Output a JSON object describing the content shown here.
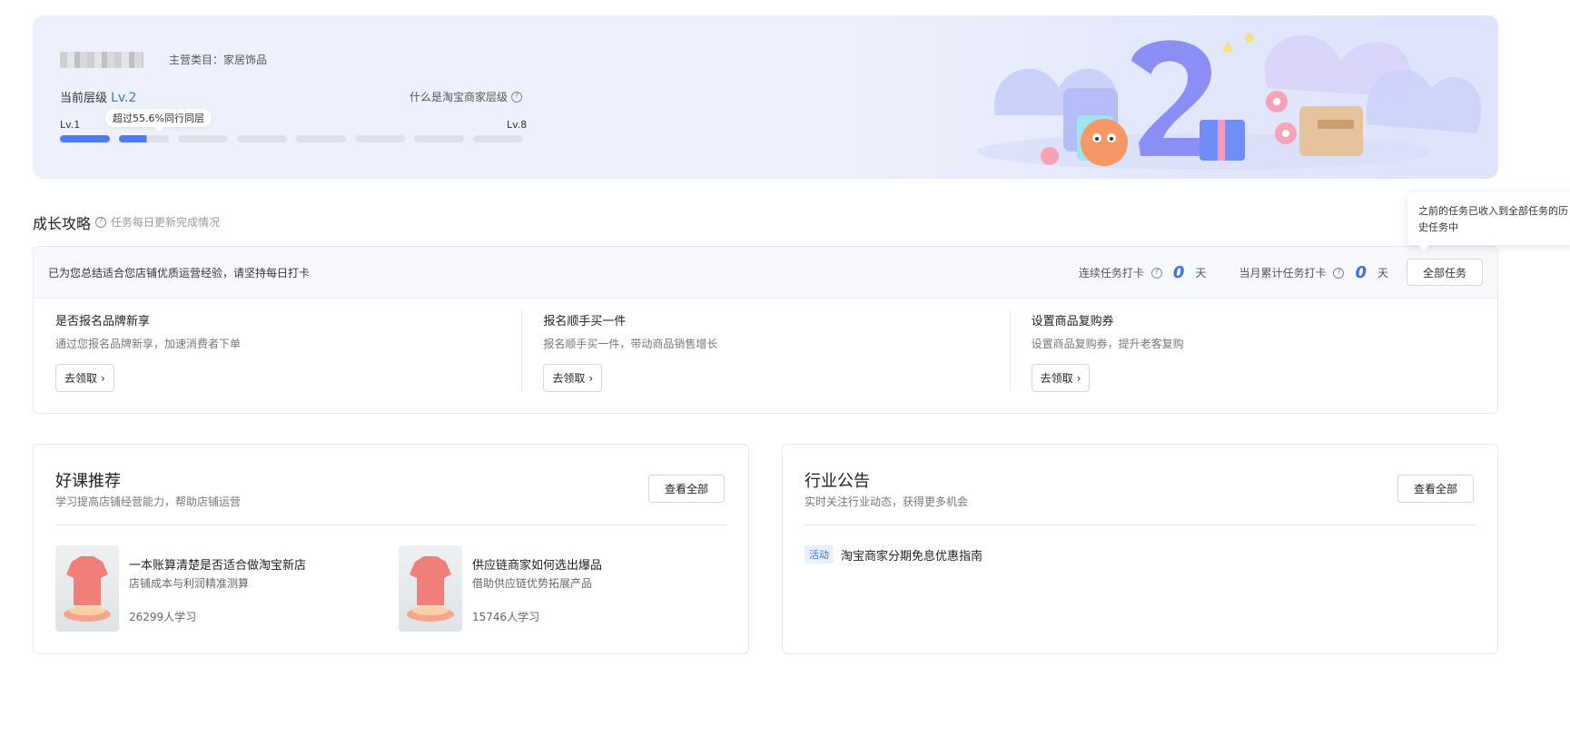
{
  "banner": {
    "category": "主营类目：家居饰品",
    "level_label": "当前层级",
    "level_value": "Lv.2",
    "what_level": "什么是淘宝商家层级",
    "level_start": "Lv.1",
    "level_end": "Lv.8",
    "beat_tip": "超过55.6%同行同层",
    "progress_segments": 8,
    "progress_completed": 1.55
  },
  "growth": {
    "title": "成长攻略",
    "subtitle": "任务每日更新完成情况",
    "head_text": "已为您总结适合您店铺优质运营经验，请坚持每日打卡",
    "streak_label": "连续任务打卡",
    "streak_value": "0",
    "streak_unit": "天",
    "month_label": "当月累计任务打卡",
    "month_value": "0",
    "month_unit": "天",
    "all_tasks_label": "全部任务",
    "popover_text": "之前的任务已收入到全部任务的历史任务中",
    "tasks": [
      {
        "title": "是否报名品牌新享",
        "desc": "通过您报名品牌新享，加速消费者下单",
        "button": "去领取"
      },
      {
        "title": "报名顺手买一件",
        "desc": "报名顺手买一件，带动商品销售增长",
        "button": "去领取"
      },
      {
        "title": "设置商品复购券",
        "desc": "设置商品复购券，提升老客复购",
        "button": "去领取"
      }
    ]
  },
  "courses": {
    "title": "好课推荐",
    "subtitle": "学习提高店铺经营能力，帮助店铺运营",
    "view_all": "查看全部",
    "items": [
      {
        "title": "一本账算清楚是否适合做淘宝新店",
        "desc": "店铺成本与利润精准测算",
        "count": "26299人学习"
      },
      {
        "title": "供应链商家如何选出爆品",
        "desc": "借助供应链优势拓展产品",
        "count": "15746人学习"
      }
    ]
  },
  "notices": {
    "title": "行业公告",
    "subtitle": "实时关注行业动态，获得更多机会",
    "view_all": "查看全部",
    "items": [
      {
        "tag": "活动",
        "text": "淘宝商家分期免息优惠指南"
      }
    ]
  },
  "colors": {
    "accent": "#3b6ff5",
    "progress": "#4d7cf6"
  }
}
